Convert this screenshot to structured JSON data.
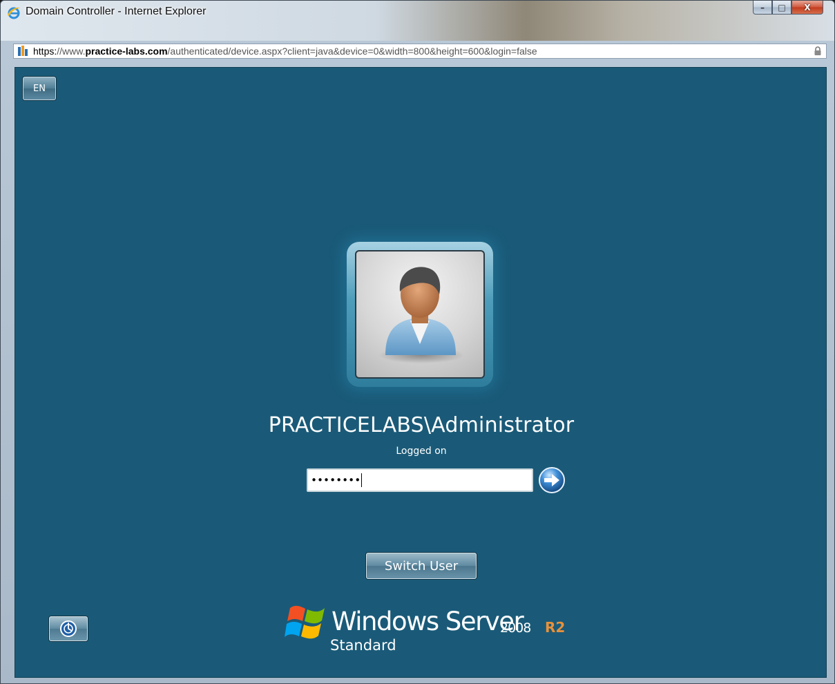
{
  "window": {
    "title": "Domain Controller - Internet Explorer",
    "caption": {
      "minimize": "–",
      "maximize": "□",
      "close": "X"
    }
  },
  "address_bar": {
    "scheme": "https:",
    "slashes": "//www.",
    "domain": "practice-labs.com",
    "path": "/authenticated/device.aspx?client=java&device=0&width=800&height=600&login=false"
  },
  "login": {
    "language": "EN",
    "account": "PRACTICELABS\\Administrator",
    "status": "Logged on",
    "password_mask": "••••••••",
    "switch_user_label": "Switch User"
  },
  "branding": {
    "product": "Windows Server",
    "version": "2008",
    "release": "R2",
    "edition": "Standard"
  },
  "colors": {
    "desktop_bg": "#1a5a78",
    "r2_accent": "#e8913a"
  },
  "icons": {
    "browser": "internet-explorer-icon",
    "site": "practice-labs-favicon",
    "lock": "lock-icon",
    "go": "arrow-right-circle-icon",
    "ease_of_access": "ease-of-access-icon",
    "user": "user-avatar-icon",
    "windows": "windows-flag-icon"
  }
}
